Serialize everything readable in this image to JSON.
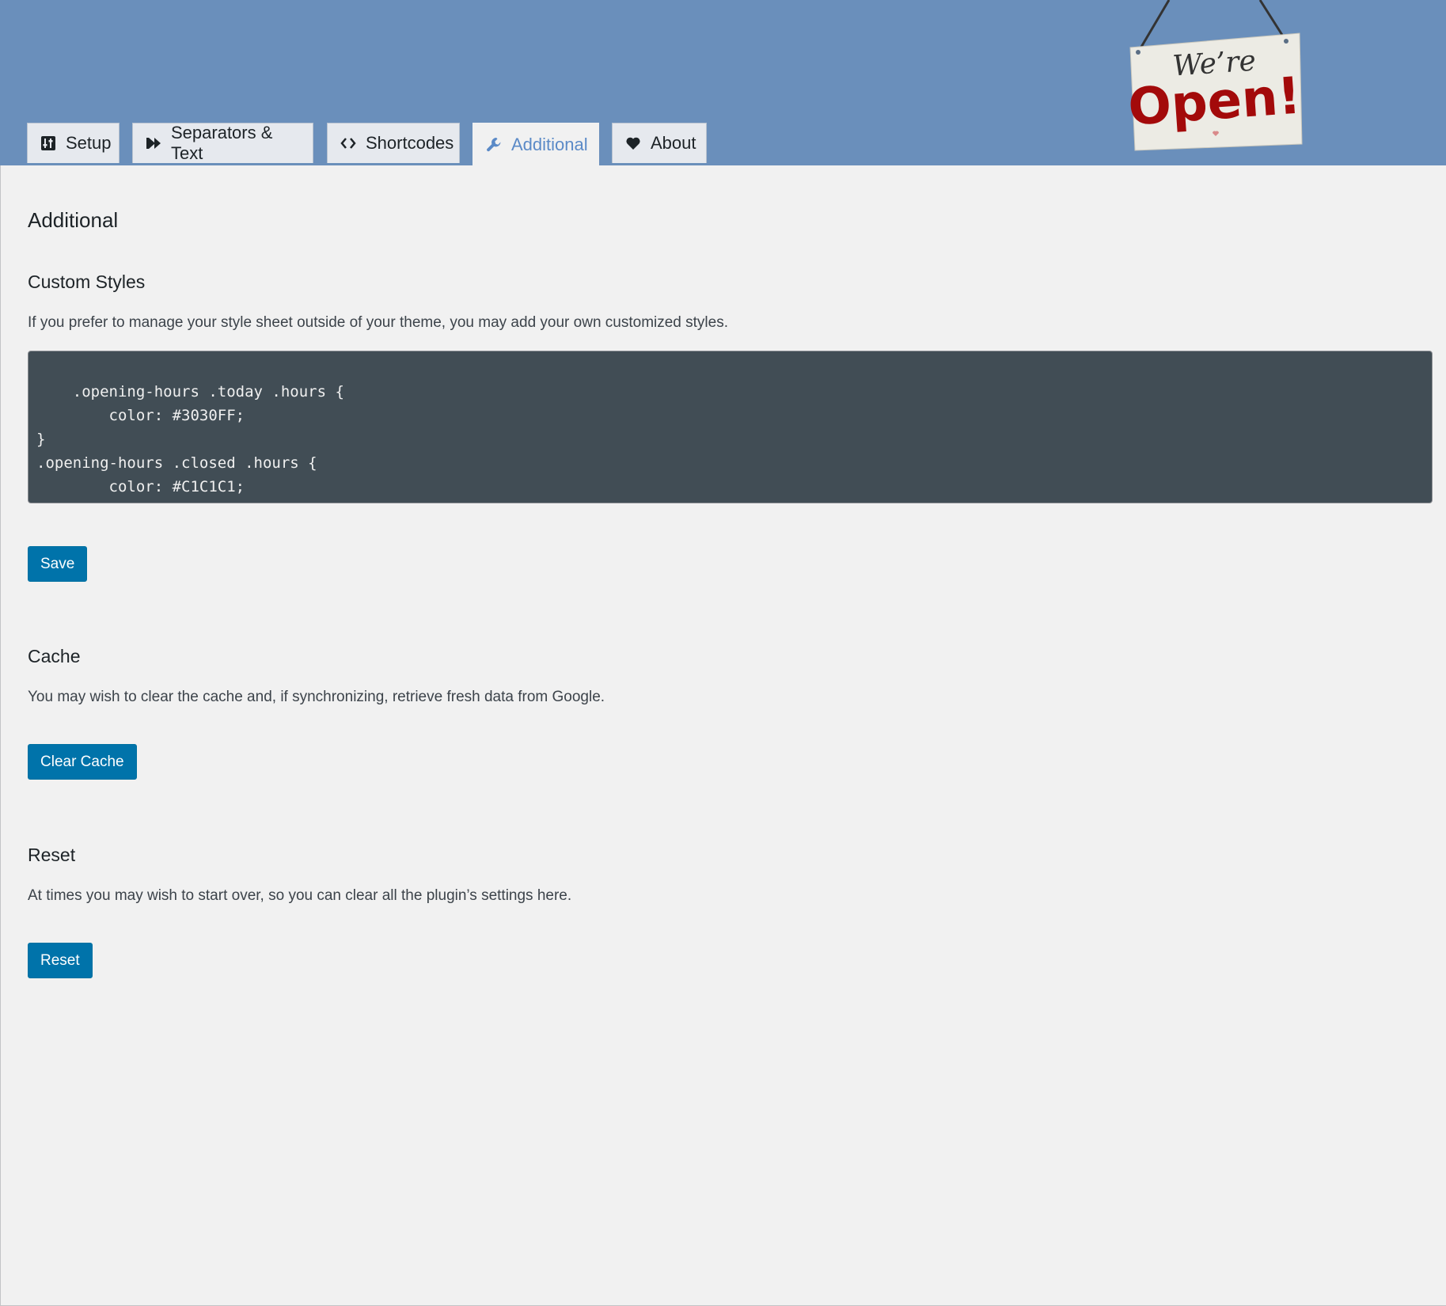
{
  "tabs": [
    {
      "label": "Setup",
      "icon": "sliders-icon"
    },
    {
      "label": "Separators & Text",
      "icon": "fast-forward-icon"
    },
    {
      "label": "Shortcodes",
      "icon": "code-icon"
    },
    {
      "label": "Additional",
      "icon": "wrench-icon",
      "active": true
    },
    {
      "label": "About",
      "icon": "heart-icon"
    }
  ],
  "sign": {
    "line1": "We're",
    "line2": "Open!"
  },
  "page_title": "Additional",
  "custom_styles": {
    "heading": "Custom Styles",
    "description": "If you prefer to manage your style sheet outside of your theme, you may add your own customized styles.",
    "code": ".opening-hours .today .hours {\n\tcolor: #3030FF;\n}\n.opening-hours .closed .hours {\n\tcolor: #C1C1C1;\n}",
    "save_label": "Save"
  },
  "cache": {
    "heading": "Cache",
    "description": "You may wish to clear the cache and, if synchronizing, retrieve fresh data from Google.",
    "button_label": "Clear Cache"
  },
  "reset": {
    "heading": "Reset",
    "description": "At times you may wish to start over, so you can clear all the plugin’s settings here.",
    "button_label": "Reset"
  },
  "colors": {
    "header_bg": "#6a8fbb",
    "accent": "#5b8ac7",
    "button_bg": "#0073aa",
    "code_bg": "#414d55",
    "sign_red": "#a30a0a"
  }
}
